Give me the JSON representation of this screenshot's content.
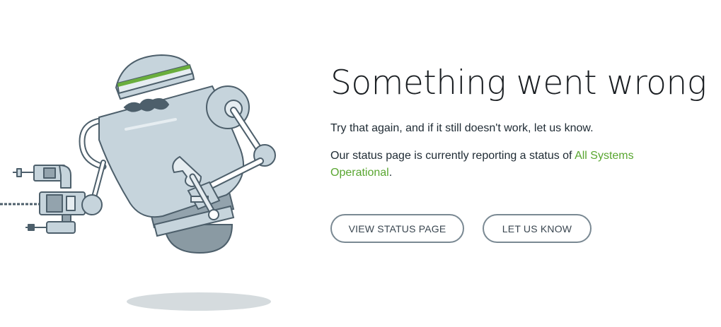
{
  "main": {
    "title": "Something went wrong",
    "retry_text": "Try that again, and if it still doesn't work, let us know.",
    "status_prefix": "Our status page is currently reporting a status of ",
    "status_value": "All Systems Operational",
    "status_suffix": ".",
    "buttons": {
      "view_status": "VIEW STATUS PAGE",
      "let_us_know": "LET US KNOW"
    }
  },
  "colors": {
    "accent_green": "#59a630",
    "button_border": "#7a8993",
    "robot_body": "#c6d4dc",
    "robot_outline": "#4d5f6b"
  },
  "icons": {
    "illustration": "robot-with-wrench-illustration"
  }
}
